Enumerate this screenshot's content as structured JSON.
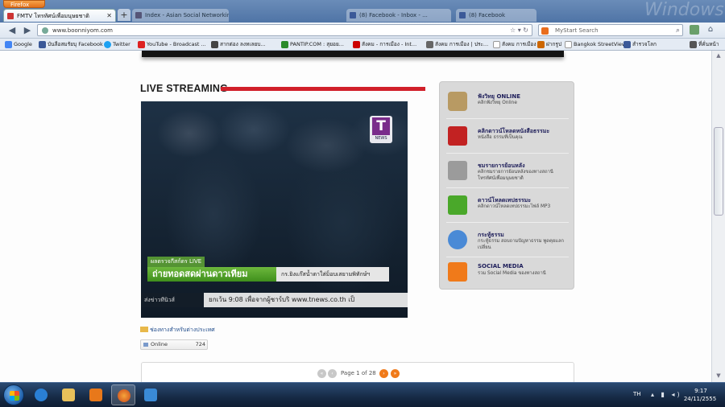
{
  "browser": {
    "menu_button": "Firefox",
    "tabs": [
      {
        "label": "FMTV โทรทัศน์เพื่อมนุษยชาติ",
        "active": true
      },
      {
        "label": "Index - Asian Social Networking Se...",
        "active": false
      },
      {
        "label": "(8) Facebook - Inbox - ...",
        "active": false
      },
      {
        "label": "(8) Facebook",
        "active": false
      }
    ],
    "new_tab_label": "+",
    "url": "www.boonniyom.com",
    "search_placeholder": "MyStart Search",
    "bookmarks": [
      {
        "label": "Google",
        "color": "#4285f4"
      },
      {
        "label": "บันลือสมรัยบุ Facebook",
        "color": "#3b5998"
      },
      {
        "label": "Twitter",
        "color": "#1da1f2"
      },
      {
        "label": "YouTube - Broadcast ...",
        "color": "#d22"
      },
      {
        "label": "สากต่อง ลงทเลยบ...",
        "color": "#444"
      },
      {
        "label": "PANTIP.COM : สุยอย...",
        "color": "#2a8a2a"
      },
      {
        "label": "สังคม - การเมือง - Int...",
        "color": "#c00"
      },
      {
        "label": "สังคม การเมือง | ประ...",
        "color": "#666"
      },
      {
        "label": "สังคม การเมือง",
        "color": "#999"
      },
      {
        "label": "ฝากรูป",
        "color": "#c60"
      },
      {
        "label": "Bangkok StreetView",
        "color": "#999"
      },
      {
        "label": "สำรวจโลก",
        "color": "#3b5998"
      },
      {
        "label": "ที่คั่นหน้า",
        "color": "#555"
      }
    ]
  },
  "page": {
    "live_title": "LIVE STREAMING",
    "video": {
      "channel_logo": "T",
      "channel_logo_sub": "NEWS",
      "caption_top": "ผลตรวจกีสก์ดร LIVE",
      "caption_main": "ถ่ายทอดสดผ่านดาวเทียม",
      "caption_right": "กร.ยิงแก๊สน้ำตาใส่ม็อบเสยามพิทักษ์ฯ",
      "ticker_label": "ส่งข่าวทีนิวส์",
      "ticker_text": "ยกเว้น 9:08 เพื่อจากผู้ชาร์บริ www.tnews.co.th เป็"
    },
    "channel_link": "ช่องทางสำหรับต่างประเทศ",
    "online": {
      "label": "Online",
      "count": "724"
    },
    "pagination": {
      "text": "Page 1 of 28"
    }
  },
  "sidebar": {
    "items": [
      {
        "title": "ฟังวิทยุ ONLINE",
        "desc": "คลิกฟังวิทยุ Online",
        "icon_color": "#b89a63"
      },
      {
        "title": "คลิกดาวน์โหลดหนังสือธรรมะ",
        "desc": "หนังสือ ธรรมที่เป็นคุณ",
        "icon_color": "#c22222"
      },
      {
        "title": "ชมรายการย้อนหลัง",
        "desc": "คลิกชมรายการย้อนหลังของทางสถานี โทรทัศน์เพื่อมนุษยชาติ",
        "icon_color": "#9b9b9b"
      },
      {
        "title": "ดาวน์โหลดเทปธรรมะ",
        "desc": "คลิกดาวน์โหลดเทปธรรมะไฟล์ MP3",
        "icon_color": "#4aa82a"
      },
      {
        "title": "กระทู้ธรรม",
        "desc": "กระทู้ธรรม สอบถามปัญหาธรรม พูดคุยแลกเปลี่ยน",
        "icon_color": "#4a8ad6"
      },
      {
        "title": "SOCIAL MEDIA",
        "desc": "รวม Social Media ของทางสถานี",
        "icon_color": "#f07a1a"
      }
    ]
  },
  "taskbar": {
    "language": "TH",
    "time": "9:17",
    "date": "24/11/2555"
  }
}
